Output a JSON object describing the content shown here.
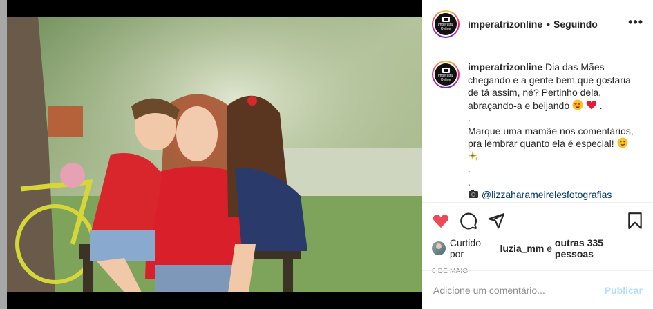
{
  "post": {
    "username": "imperatrizonline",
    "separator": "•",
    "follow_status": "Seguindo",
    "more_label": "•••",
    "avatar_text": "Imperatriz Online"
  },
  "caption": {
    "username": "imperatrizonline",
    "line1": "Dia das Mães chegando e a gente bem que gostaria de tá assim, né? Pertinho dela, abraçando-a e beijando",
    "line1_end": ".",
    "dot1": ".",
    "line2": "Marque uma mamãe nos comentários, pra lembrar quanto ela é especial!",
    "dot2": ".",
    "dot3": ".",
    "mention": "@lizzaharameirelesfotografias"
  },
  "icons": {
    "like": "heart-icon",
    "comment": "comment-icon",
    "share": "share-icon",
    "save": "bookmark-icon",
    "camera": "camera-emoji",
    "star_eyes": "star-struck-emoji",
    "heart": "red-heart-emoji",
    "wink": "winking-face-emoji",
    "sparkles": "sparkles-emoji"
  },
  "likes": {
    "prefix": "Curtido por",
    "user": "luzia_mm",
    "middle": "e",
    "others": "outras 335 pessoas"
  },
  "date": "8 DE MAIO",
  "comment": {
    "placeholder": "Adicione um comentário...",
    "publish": "Publicar"
  },
  "colors": {
    "like_red": "#ed4956",
    "link": "#00376b",
    "publish_disabled": "#b2dffc",
    "muted": "#8e8e8e"
  }
}
